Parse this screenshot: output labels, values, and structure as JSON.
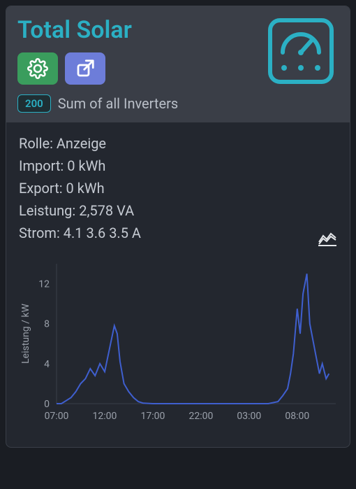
{
  "header": {
    "title": "Total Solar",
    "badge": "200",
    "subtitle": "Sum of all Inverters"
  },
  "metrics": {
    "rolle_label": "Rolle:",
    "rolle_value": "Anzeige",
    "import_label": "Import:",
    "import_value": "0 kWh",
    "export_label": "Export:",
    "export_value": "0 kWh",
    "leistung_label": "Leistung:",
    "leistung_value": "2,578 VA",
    "strom_label": "Strom:",
    "strom_value": "4.1 3.6 3.5 A"
  },
  "chart_data": {
    "type": "line",
    "title": "",
    "xlabel": "",
    "ylabel": "Leistung / kW",
    "ylim": [
      0,
      14
    ],
    "y_ticks": [
      0,
      4,
      8,
      12
    ],
    "x_ticks": [
      "07:00",
      "12:00",
      "17:00",
      "22:00",
      "03:00",
      "08:00"
    ],
    "x": [
      7.0,
      7.5,
      8.0,
      8.5,
      9.0,
      9.5,
      10.0,
      10.5,
      11.0,
      11.5,
      12.0,
      12.5,
      13.0,
      13.3,
      13.6,
      14.0,
      14.5,
      15.0,
      15.5,
      16.0,
      17.0,
      18.0,
      19.0,
      20.0,
      21.0,
      22.0,
      23.0,
      24.0,
      25.0,
      26.0,
      27.0,
      28.0,
      29.0,
      30.0,
      30.5,
      31.0,
      31.3,
      31.6,
      32.0,
      32.3,
      32.6,
      33.0,
      33.3,
      33.6,
      34.0,
      34.3,
      34.6,
      35.0,
      35.3
    ],
    "values": [
      0,
      0,
      0.3,
      0.6,
      1.2,
      2.0,
      2.5,
      3.5,
      2.8,
      4.0,
      3.2,
      5.5,
      7.8,
      7.0,
      4.2,
      2.0,
      1.2,
      0.6,
      0.2,
      0.05,
      0,
      0,
      0,
      0,
      0,
      0,
      0,
      0,
      0,
      0,
      0,
      0,
      0,
      0.2,
      0.8,
      1.5,
      3.0,
      5.0,
      9.5,
      7.0,
      11.0,
      13.0,
      8.0,
      6.5,
      4.5,
      3.0,
      4.0,
      2.5,
      3.0
    ]
  }
}
